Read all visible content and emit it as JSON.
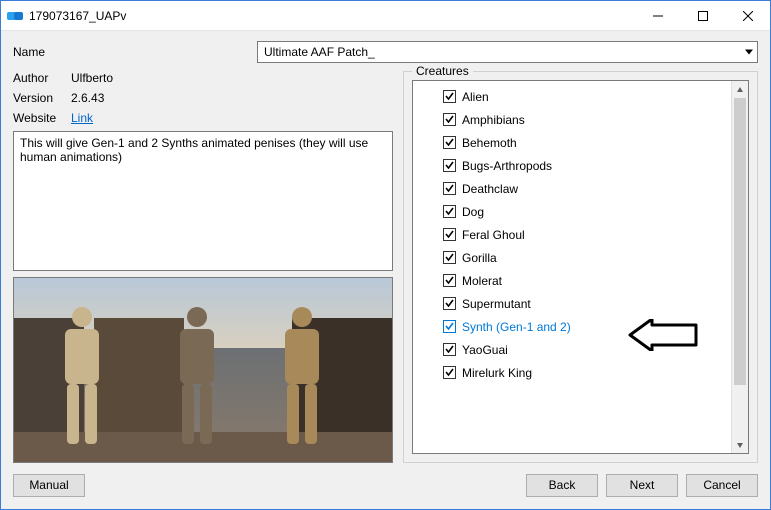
{
  "window": {
    "title": "179073167_UAPv"
  },
  "labels": {
    "name": "Name",
    "author": "Author",
    "version": "Version",
    "website": "Website",
    "creatures": "Creatures"
  },
  "meta": {
    "name_value": "Ultimate AAF Patch_",
    "author_value": "Ulfberto",
    "version_value": "2.6.43",
    "website_link_text": "Link"
  },
  "description": "This will give Gen-1 and 2 Synths animated penises (they will use human animations)",
  "creatures": [
    {
      "label": "Alien",
      "checked": true,
      "highlight": false
    },
    {
      "label": "Amphibians",
      "checked": true,
      "highlight": false
    },
    {
      "label": "Behemoth",
      "checked": true,
      "highlight": false
    },
    {
      "label": "Bugs-Arthropods",
      "checked": true,
      "highlight": false
    },
    {
      "label": "Deathclaw",
      "checked": true,
      "highlight": false
    },
    {
      "label": "Dog",
      "checked": true,
      "highlight": false
    },
    {
      "label": "Feral Ghoul",
      "checked": true,
      "highlight": false
    },
    {
      "label": "Gorilla",
      "checked": true,
      "highlight": false
    },
    {
      "label": "Molerat",
      "checked": true,
      "highlight": false
    },
    {
      "label": "Supermutant",
      "checked": true,
      "highlight": false
    },
    {
      "label": "Synth (Gen-1 and 2)",
      "checked": true,
      "highlight": true
    },
    {
      "label": "YaoGuai",
      "checked": true,
      "highlight": false
    },
    {
      "label": "Mirelurk King",
      "checked": true,
      "highlight": false
    }
  ],
  "buttons": {
    "manual": "Manual",
    "back": "Back",
    "next": "Next",
    "cancel": "Cancel"
  }
}
